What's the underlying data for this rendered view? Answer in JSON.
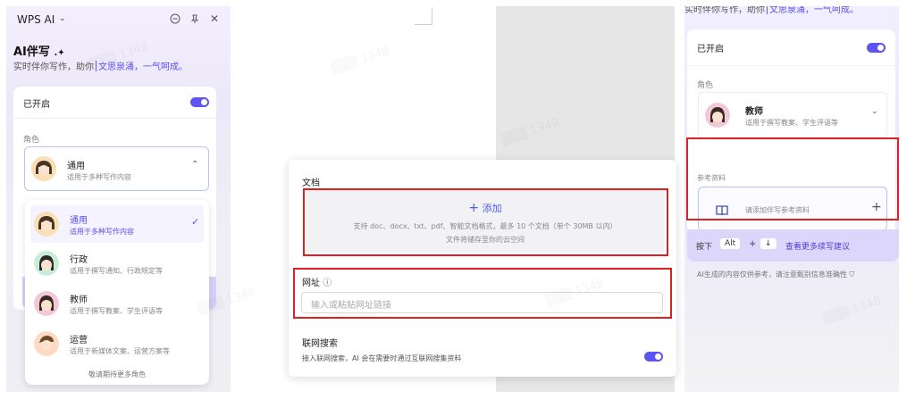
{
  "left_panel": {
    "title": "WPS AI",
    "heading": "AI伴写",
    "subtitle_pre": "实时伴你写作，助你",
    "subtitle_highlight": "文思泉涌，一气呵成。",
    "enabled_label": "已开启",
    "role_label": "角色",
    "selected_role": {
      "name": "通用",
      "desc": "适用于多种写作内容"
    },
    "roles": [
      {
        "name": "通用",
        "desc": "适用于多种写作内容",
        "selected": true
      },
      {
        "name": "行政",
        "desc": "适用于撰写通知、行政规定等",
        "selected": false
      },
      {
        "name": "教师",
        "desc": "适用于撰写教案、学生评语等",
        "selected": false
      },
      {
        "name": "运营",
        "desc": "适用于新媒体文案、运营方案等",
        "selected": false
      }
    ],
    "more_roles": "敬请期待更多角色"
  },
  "dialog": {
    "doc_label": "文档",
    "add_label": "添加",
    "doc_support": "支持 doc、docx、txt、pdf、智能文档格式，最多 10 个文档（单个 30MB 以内）",
    "doc_storage": "文件将储存至你的云空间",
    "url_label": "网址",
    "url_placeholder": "输入或粘贴网址链接",
    "web_search_label": "联网搜索",
    "web_search_desc": "接入联网搜索，AI 会在需要时通过互联网搜集资料"
  },
  "right_panel": {
    "subtitle_pre": "实时伴你写作，助你",
    "subtitle_highlight": "文思泉涌，一气呵成。",
    "enabled_label": "已开启",
    "role_label": "角色",
    "role": {
      "name": "教师",
      "desc": "适用于撰写教案、学生评语等"
    },
    "ref_label": "参考资料",
    "ref_placeholder": "请添加伴写参考资料",
    "hint_press": "按下",
    "hint_key1": "Alt",
    "hint_plus": "+",
    "hint_key2": "↓",
    "hint_text": "查看更多续写建议",
    "disclaimer": "AI生成的内容仅供参考，请注意甄别信息准确性"
  },
  "colors": {
    "accent": "#5d54f2",
    "highlight_box": "#e02020"
  }
}
